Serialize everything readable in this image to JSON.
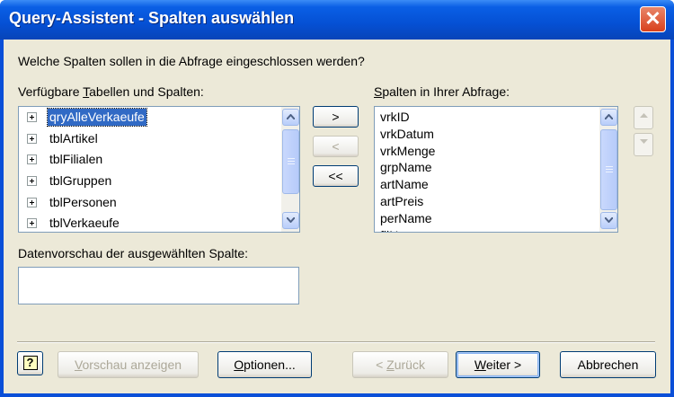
{
  "window": {
    "title": "Query-Assistent - Spalten auswählen",
    "close_glyph": "✕"
  },
  "prompt_text": "Welche Spalten sollen in die Abfrage eingeschlossen werden?",
  "available": {
    "label_pre": "Verfügbare ",
    "label_accel": "T",
    "label_post": "abellen und Spalten:",
    "items": [
      {
        "label": "qryAlleVerkaeufe",
        "expanded": false,
        "selected": true
      },
      {
        "label": "tblArtikel",
        "expanded": false,
        "selected": false
      },
      {
        "label": "tblFilialen",
        "expanded": false,
        "selected": false
      },
      {
        "label": "tblGruppen",
        "expanded": false,
        "selected": false
      },
      {
        "label": "tblPersonen",
        "expanded": false,
        "selected": false
      },
      {
        "label": "tblVerkaeufe",
        "expanded": false,
        "selected": false
      }
    ]
  },
  "selected_columns": {
    "label_accel": "S",
    "label_post": "palten in Ihrer Abfrage:",
    "items": [
      "vrkID",
      "vrkDatum",
      "vrkMenge",
      "grpName",
      "artName",
      "artPreis",
      "perName",
      "filName"
    ]
  },
  "move_buttons": {
    "add": ">",
    "remove": "<",
    "remove_all": "<<"
  },
  "preview": {
    "label": "Datenvorschau der ausgewählten Spalte:",
    "value": ""
  },
  "buttons": {
    "help_glyph": "?",
    "preview_accel": "V",
    "preview_post": "orschau anzeigen",
    "options_accel": "O",
    "options_post": "ptionen...",
    "back_pre": "< ",
    "back_accel": "Z",
    "back_post": "urück",
    "next_accel": "W",
    "next_post": "eiter >",
    "cancel": "Abbrechen"
  },
  "colors": {
    "titlebar": "#0550d4",
    "dialog_bg": "#ece9d8",
    "selection": "#316ac5",
    "close_button": "#d8401c"
  },
  "icons": [
    "close-icon",
    "scroll-up-icon",
    "scroll-down-icon",
    "expand-icon",
    "move-up-icon",
    "move-down-icon",
    "help-icon"
  ]
}
